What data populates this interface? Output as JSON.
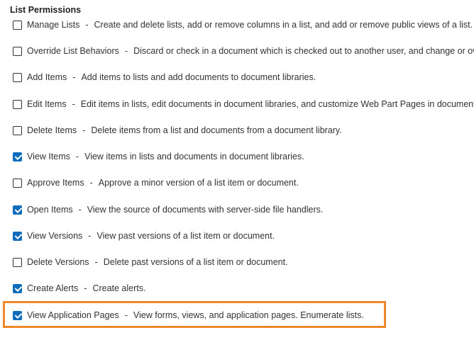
{
  "section": {
    "title": "List Permissions"
  },
  "permissions": [
    {
      "name": "Manage Lists",
      "sep": "-",
      "desc": "Create and delete lists, add or remove columns in a list, and add or remove public views of a list.",
      "checked": false
    },
    {
      "name": "Override List Behaviors",
      "sep": "-",
      "desc": "Discard or check in a document which is checked out to another user, and change or override settings which allow users to read/edit only their own items",
      "checked": false
    },
    {
      "name": "Add Items",
      "sep": "-",
      "desc": "Add items to lists and add documents to document libraries.",
      "checked": false
    },
    {
      "name": "Edit Items",
      "sep": "-",
      "desc": "Edit items in lists, edit documents in document libraries, and customize Web Part Pages in document libraries.",
      "checked": false
    },
    {
      "name": "Delete Items",
      "sep": "-",
      "desc": "Delete items from a list and documents from a document library.",
      "checked": false
    },
    {
      "name": "View Items",
      "sep": "-",
      "desc": "View items in lists and documents in document libraries.",
      "checked": true
    },
    {
      "name": "Approve Items",
      "sep": "-",
      "desc": "Approve a minor version of a list item or document.",
      "checked": false
    },
    {
      "name": "Open Items",
      "sep": "-",
      "desc": "View the source of documents with server-side file handlers.",
      "checked": true
    },
    {
      "name": "View Versions",
      "sep": "-",
      "desc": "View past versions of a list item or document.",
      "checked": true
    },
    {
      "name": "Delete Versions",
      "sep": "-",
      "desc": "Delete past versions of a list item or document.",
      "checked": false
    },
    {
      "name": "Create Alerts",
      "sep": "-",
      "desc": "Create alerts.",
      "checked": true
    },
    {
      "name": "View Application Pages",
      "sep": "-",
      "desc": "View forms, views, and application pages. Enumerate lists.",
      "checked": true
    }
  ],
  "colors": {
    "checkbox_checked": "#0f6cbd",
    "highlight": "#f0882a",
    "text": "#333333"
  }
}
